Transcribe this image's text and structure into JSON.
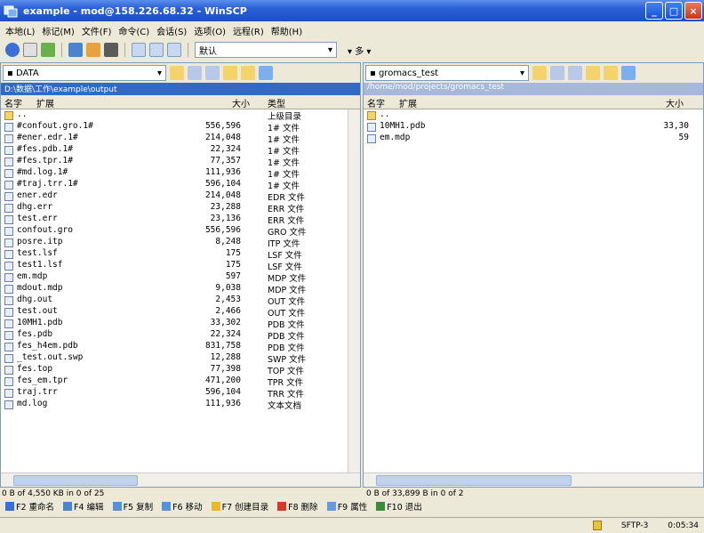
{
  "window": {
    "title": "example - mod@158.226.68.32 - WinSCP",
    "controls": [
      "_",
      "□",
      "×"
    ]
  },
  "menu": [
    "本地(L)",
    "标记(M)",
    "文件(F)",
    "命令(C)",
    "会话(S)",
    "选项(O)",
    "远程(R)",
    "帮助(H)"
  ],
  "toolbar": {
    "profile": "默认",
    "extra": "▾ 多 ▾"
  },
  "left": {
    "drive": "▪ DATA",
    "path": "D:\\数据\\工作\\example\\output",
    "columns": {
      "name": "名字",
      "ext": "扩展",
      "size": "大小",
      "type": "类型"
    },
    "files": [
      {
        "name": "..",
        "size": "",
        "type": "上级目录",
        "kind": "up"
      },
      {
        "name": "#confout.gro.1#",
        "size": "556,596",
        "type": "1# 文件"
      },
      {
        "name": "#ener.edr.1#",
        "size": "214,048",
        "type": "1# 文件"
      },
      {
        "name": "#fes.pdb.1#",
        "size": "22,324",
        "type": "1# 文件"
      },
      {
        "name": "#fes.tpr.1#",
        "size": "77,357",
        "type": "1# 文件"
      },
      {
        "name": "#md.log.1#",
        "size": "111,936",
        "type": "1# 文件"
      },
      {
        "name": "#traj.trr.1#",
        "size": "596,104",
        "type": "1# 文件"
      },
      {
        "name": "ener.edr",
        "size": "214,048",
        "type": "EDR 文件"
      },
      {
        "name": "dhg.err",
        "size": "23,288",
        "type": "ERR 文件"
      },
      {
        "name": "test.err",
        "size": "23,136",
        "type": "ERR 文件"
      },
      {
        "name": "confout.gro",
        "size": "556,596",
        "type": "GRO 文件"
      },
      {
        "name": "posre.itp",
        "size": "8,248",
        "type": "ITP 文件"
      },
      {
        "name": "test.lsf",
        "size": "175",
        "type": "LSF 文件"
      },
      {
        "name": "test1.lsf",
        "size": "175",
        "type": "LSF 文件"
      },
      {
        "name": "em.mdp",
        "size": "597",
        "type": "MDP 文件"
      },
      {
        "name": "mdout.mdp",
        "size": "9,038",
        "type": "MDP 文件"
      },
      {
        "name": "dhg.out",
        "size": "2,453",
        "type": "OUT 文件"
      },
      {
        "name": "test.out",
        "size": "2,466",
        "type": "OUT 文件"
      },
      {
        "name": "10MH1.pdb",
        "size": "33,302",
        "type": "PDB 文件"
      },
      {
        "name": "fes.pdb",
        "size": "22,324",
        "type": "PDB 文件"
      },
      {
        "name": "fes_h4em.pdb",
        "size": "831,758",
        "type": "PDB 文件"
      },
      {
        "name": "_test.out.swp",
        "size": "12,288",
        "type": "SWP 文件"
      },
      {
        "name": "fes.top",
        "size": "77,398",
        "type": "TOP 文件"
      },
      {
        "name": "fes_em.tpr",
        "size": "471,200",
        "type": "TPR 文件"
      },
      {
        "name": "traj.trr",
        "size": "596,104",
        "type": "TRR 文件"
      },
      {
        "name": "md.log",
        "size": "111,936",
        "type": "文本文档"
      }
    ],
    "status": "0 B of 4,550 KB in 0 of 25"
  },
  "right": {
    "drive": "▪ gromacs_test",
    "path": "/home/mod/projects/gromacs_test",
    "columns": {
      "name": "名字",
      "ext": "扩展",
      "size": "大小"
    },
    "files": [
      {
        "name": "..",
        "size": "",
        "kind": "up"
      },
      {
        "name": "10MH1.pdb",
        "size": "33,30"
      },
      {
        "name": "em.mdp",
        "size": "59"
      }
    ],
    "status": "0 B of 33,899 B in 0 of 2"
  },
  "commands": [
    {
      "label": "F2 重命名",
      "color": "#3a6fd8"
    },
    {
      "label": "F4 编辑",
      "color": "#4a84d0"
    },
    {
      "label": "F5 复制",
      "color": "#5a90d8"
    },
    {
      "label": "F6 移动",
      "color": "#5a90d8"
    },
    {
      "label": "F7 创建目录",
      "color": "#e8b830"
    },
    {
      "label": "F8 删除",
      "color": "#d03a2a"
    },
    {
      "label": "F9 属性",
      "color": "#6a9ad8"
    },
    {
      "label": "F10 退出",
      "color": "#3a8a3a"
    }
  ],
  "statusbar": {
    "protocol": "SFTP-3",
    "time": "0:05:34"
  }
}
